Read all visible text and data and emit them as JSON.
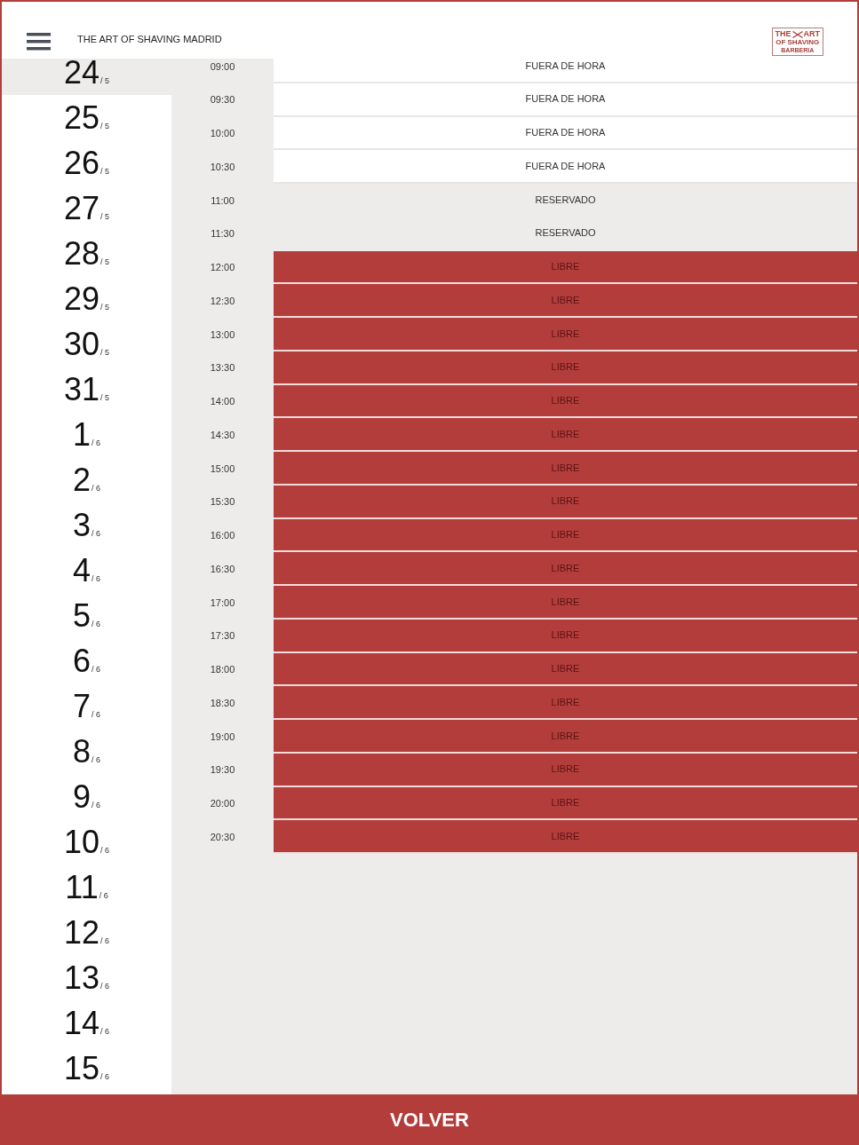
{
  "header": {
    "title": "THE ART OF SHAVING MADRID",
    "logo": {
      "line_1_left": "THE",
      "line_1_right": "ART",
      "line_2": "OF SHAVING",
      "line_3": "BARBERIA"
    }
  },
  "dates": [
    {
      "day": "24",
      "month": "/ 5",
      "selected": true
    },
    {
      "day": "25",
      "month": "/ 5",
      "selected": false
    },
    {
      "day": "26",
      "month": "/ 5",
      "selected": false
    },
    {
      "day": "27",
      "month": "/ 5",
      "selected": false
    },
    {
      "day": "28",
      "month": "/ 5",
      "selected": false
    },
    {
      "day": "29",
      "month": "/ 5",
      "selected": false
    },
    {
      "day": "30",
      "month": "/ 5",
      "selected": false
    },
    {
      "day": "31",
      "month": "/ 5",
      "selected": false
    },
    {
      "day": "1",
      "month": "/ 6",
      "selected": false
    },
    {
      "day": "2",
      "month": "/ 6",
      "selected": false
    },
    {
      "day": "3",
      "month": "/ 6",
      "selected": false
    },
    {
      "day": "4",
      "month": "/ 6",
      "selected": false
    },
    {
      "day": "5",
      "month": "/ 6",
      "selected": false
    },
    {
      "day": "6",
      "month": "/ 6",
      "selected": false
    },
    {
      "day": "7",
      "month": "/ 6",
      "selected": false
    },
    {
      "day": "8",
      "month": "/ 6",
      "selected": false
    },
    {
      "day": "9",
      "month": "/ 6",
      "selected": false
    },
    {
      "day": "10",
      "month": "/ 6",
      "selected": false
    },
    {
      "day": "11",
      "month": "/ 6",
      "selected": false
    },
    {
      "day": "12",
      "month": "/ 6",
      "selected": false
    },
    {
      "day": "13",
      "month": "/ 6",
      "selected": false
    },
    {
      "day": "14",
      "month": "/ 6",
      "selected": false
    },
    {
      "day": "15",
      "month": "/ 6",
      "selected": false
    }
  ],
  "slots": [
    {
      "time": "09:00",
      "status": "FUERA DE HORA",
      "kind": "out_of_hours"
    },
    {
      "time": "09:30",
      "status": "FUERA DE HORA",
      "kind": "out_of_hours"
    },
    {
      "time": "10:00",
      "status": "FUERA DE HORA",
      "kind": "out_of_hours"
    },
    {
      "time": "10:30",
      "status": "FUERA DE HORA",
      "kind": "out_of_hours"
    },
    {
      "time": "11:00",
      "status": "RESERVADO",
      "kind": "reserved"
    },
    {
      "time": "11:30",
      "status": "RESERVADO",
      "kind": "reserved"
    },
    {
      "time": "12:00",
      "status": "LIBRE",
      "kind": "free"
    },
    {
      "time": "12:30",
      "status": "LIBRE",
      "kind": "free"
    },
    {
      "time": "13:00",
      "status": "LIBRE",
      "kind": "free"
    },
    {
      "time": "13:30",
      "status": "LIBRE",
      "kind": "free"
    },
    {
      "time": "14:00",
      "status": "LIBRE",
      "kind": "free"
    },
    {
      "time": "14:30",
      "status": "LIBRE",
      "kind": "free"
    },
    {
      "time": "15:00",
      "status": "LIBRE",
      "kind": "free"
    },
    {
      "time": "15:30",
      "status": "LIBRE",
      "kind": "free"
    },
    {
      "time": "16:00",
      "status": "LIBRE",
      "kind": "free"
    },
    {
      "time": "16:30",
      "status": "LIBRE",
      "kind": "free"
    },
    {
      "time": "17:00",
      "status": "LIBRE",
      "kind": "free"
    },
    {
      "time": "17:30",
      "status": "LIBRE",
      "kind": "free"
    },
    {
      "time": "18:00",
      "status": "LIBRE",
      "kind": "free"
    },
    {
      "time": "18:30",
      "status": "LIBRE",
      "kind": "free"
    },
    {
      "time": "19:00",
      "status": "LIBRE",
      "kind": "free"
    },
    {
      "time": "19:30",
      "status": "LIBRE",
      "kind": "free"
    },
    {
      "time": "20:00",
      "status": "LIBRE",
      "kind": "free"
    },
    {
      "time": "20:30",
      "status": "LIBRE",
      "kind": "free"
    }
  ],
  "footer": {
    "button": "VOLVER"
  }
}
